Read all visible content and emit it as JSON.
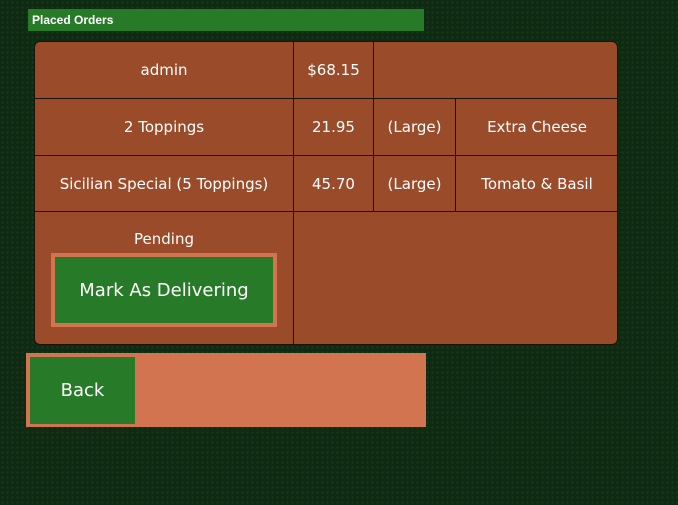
{
  "header": {
    "title": "Placed Orders"
  },
  "order": {
    "customer": "admin",
    "total": "$68.15",
    "items": [
      {
        "name": "2 Toppings",
        "price": "21.95",
        "size": "(Large)",
        "topping": "Extra Cheese"
      },
      {
        "name": "Sicilian Special (5 Toppings)",
        "price": "45.70",
        "size": "(Large)",
        "topping": "Tomato & Basil"
      }
    ],
    "status": "Pending",
    "action_label": "Mark As Delivering"
  },
  "footer": {
    "back_label": "Back"
  },
  "colors": {
    "background": "#0f2a12",
    "primary_green": "#277a27",
    "card_brown": "#9a4b2a",
    "accent_salmon": "#d2744f"
  }
}
